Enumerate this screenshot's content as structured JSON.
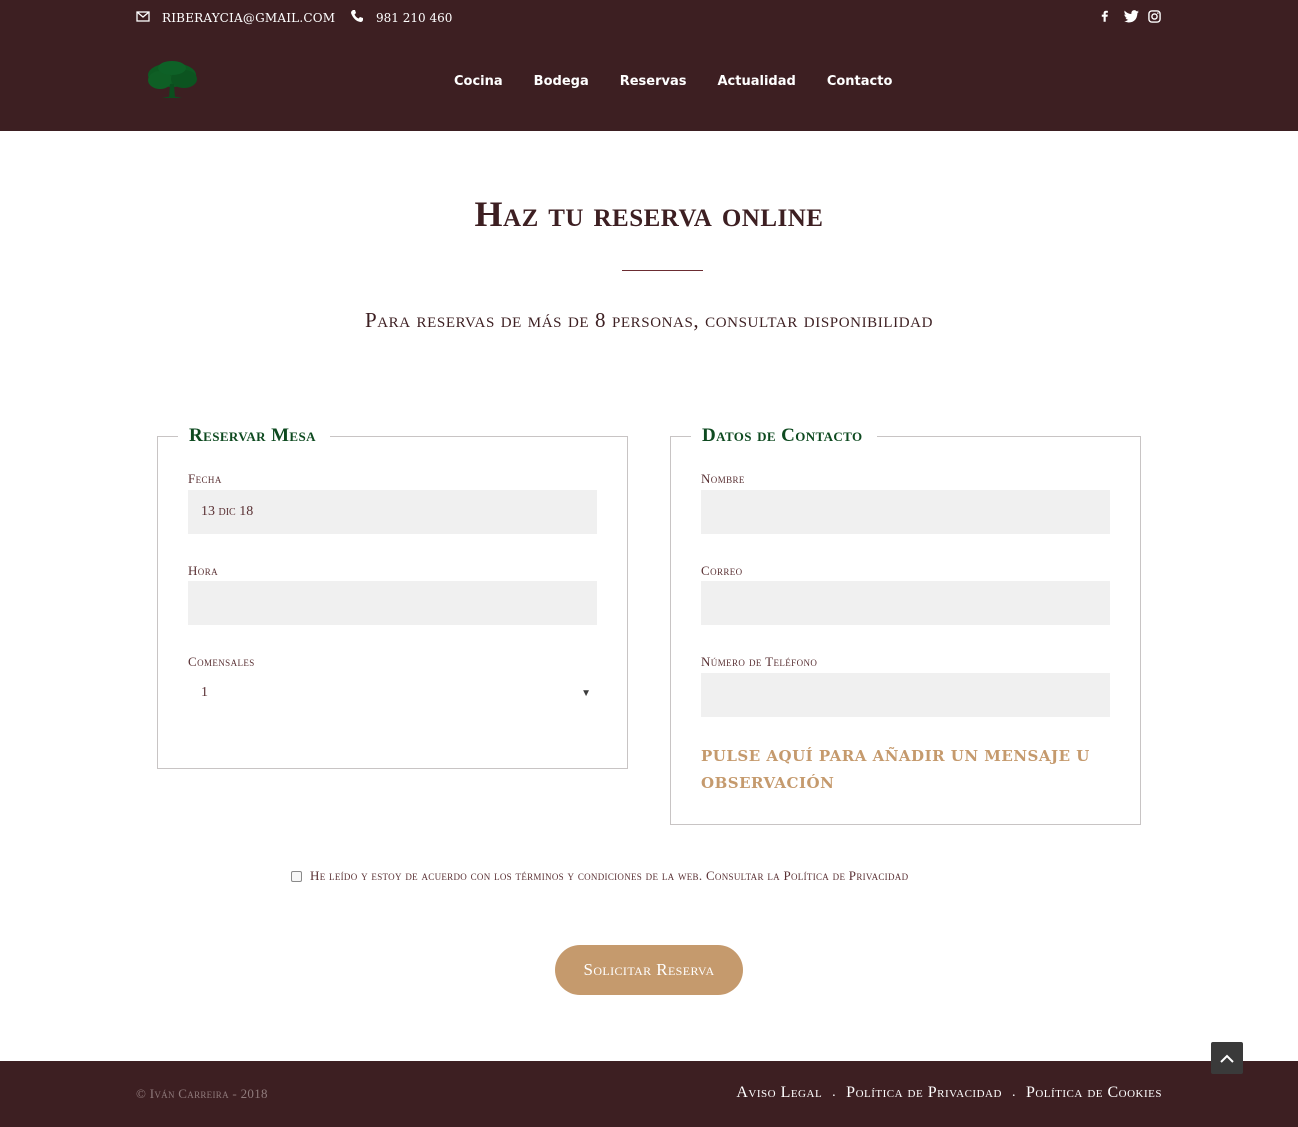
{
  "topbar": {
    "email": "RIBERAYCIA@GMAIL.COM",
    "phone": "981 210 460",
    "email_icon": "envelope-icon",
    "phone_icon": "phone-icon",
    "social": [
      "facebook-icon",
      "twitter-icon",
      "instagram-icon"
    ]
  },
  "nav": {
    "items": [
      "Cocina",
      "Bodega",
      "Reservas",
      "Actualidad",
      "Contacto"
    ]
  },
  "main": {
    "title": "Haz tu reserva online",
    "subtitle": "Para reservas de más de 8 personas, consultar disponibilidad"
  },
  "reservation": {
    "legend": "Reservar Mesa",
    "date_label": "Fecha",
    "date_value": "13 dic 18",
    "time_label": "Hora",
    "time_value": "",
    "guests_label": "Comensales",
    "guests_value": "1"
  },
  "contact": {
    "legend": "Datos de Contacto",
    "name_label": "Nombre",
    "email_label": "Correo",
    "phone_label": "Número de Teléfono",
    "add_message": "PULSE AQUÍ PARA AÑADIR UN MENSAJE U OBSERVACIÓN"
  },
  "terms": {
    "text": "He leído y estoy de acuerdo con los términos y condiciones de la web. Consultar la Política de Privacidad",
    "checked": false
  },
  "submit_label": "Solicitar Reserva",
  "footer": {
    "copyright": "© Iván Carreira - 2018",
    "links": [
      "Aviso Legal",
      "Política de Privacidad",
      "Política de Cookies"
    ],
    "separator": "."
  },
  "colors": {
    "brand_dark": "#3d1f22",
    "accent_gold": "#c59a6d",
    "heading_green": "#0e4a20"
  }
}
